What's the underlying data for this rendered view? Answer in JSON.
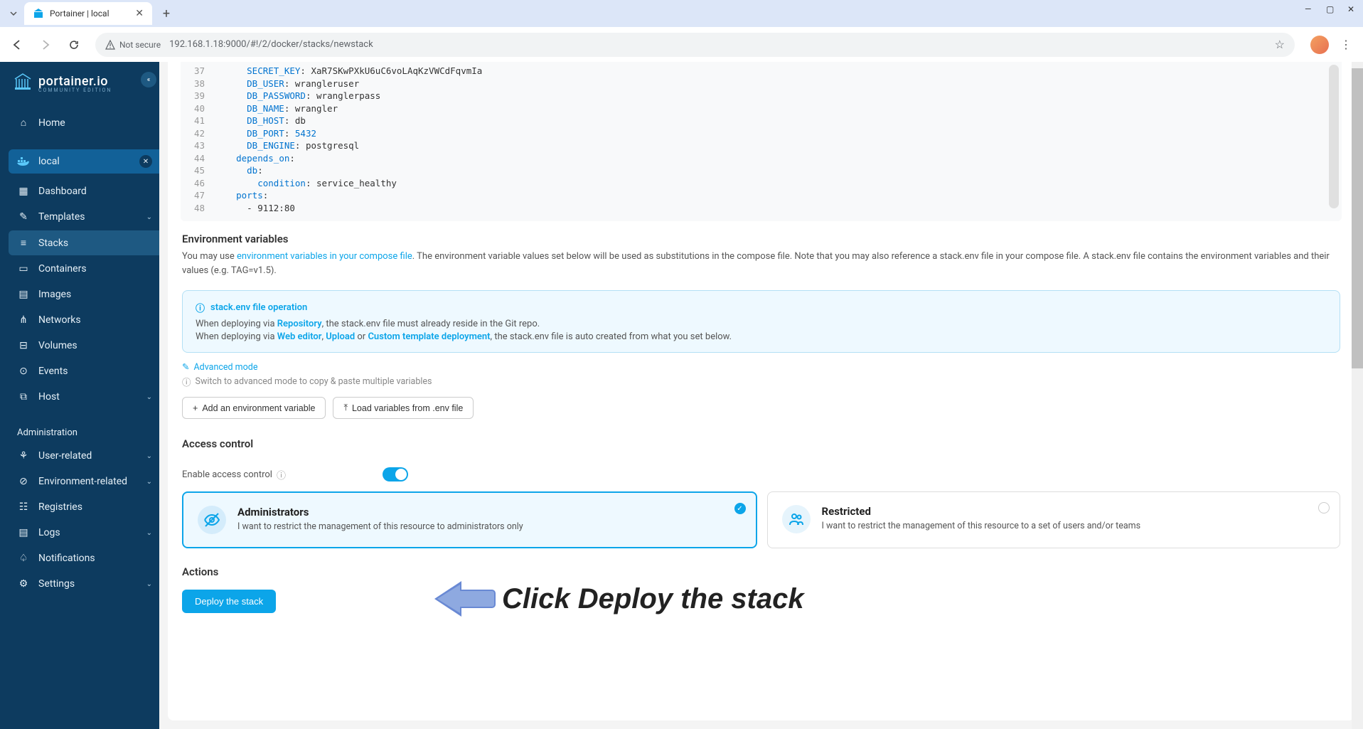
{
  "browser": {
    "tab_title": "Portainer | local",
    "url_security": "Not secure",
    "url": "192.168.1.18:9000/#!/2/docker/stacks/newstack"
  },
  "sidebar": {
    "logo_main": "portainer.io",
    "logo_sub": "COMMUNITY EDITION",
    "home": "Home",
    "env_label": "local",
    "items": [
      {
        "label": "Dashboard"
      },
      {
        "label": "Templates"
      },
      {
        "label": "Stacks"
      },
      {
        "label": "Containers"
      },
      {
        "label": "Images"
      },
      {
        "label": "Networks"
      },
      {
        "label": "Volumes"
      },
      {
        "label": "Events"
      },
      {
        "label": "Host"
      }
    ],
    "admin_label": "Administration",
    "admin_items": [
      {
        "label": "User-related"
      },
      {
        "label": "Environment-related"
      },
      {
        "label": "Registries"
      },
      {
        "label": "Logs"
      },
      {
        "label": "Notifications"
      },
      {
        "label": "Settings"
      }
    ]
  },
  "editor": {
    "lines": [
      {
        "n": 37,
        "indent": 6,
        "key": "SECRET_KEY",
        "val": "XaR7SKwPXkU6uC6voLAqKzVWCdFqvmIa"
      },
      {
        "n": 38,
        "indent": 6,
        "key": "DB_USER",
        "val": "wrangleruser"
      },
      {
        "n": 39,
        "indent": 6,
        "key": "DB_PASSWORD",
        "val": "wranglerpass"
      },
      {
        "n": 40,
        "indent": 6,
        "key": "DB_NAME",
        "val": "wrangler"
      },
      {
        "n": 41,
        "indent": 6,
        "key": "DB_HOST",
        "val": "db"
      },
      {
        "n": 42,
        "indent": 6,
        "key": "DB_PORT",
        "val": "5432",
        "num": true
      },
      {
        "n": 43,
        "indent": 6,
        "key": "DB_ENGINE",
        "val": "postgresql"
      },
      {
        "n": 44,
        "indent": 4,
        "key": "depends_on",
        "val": ""
      },
      {
        "n": 45,
        "indent": 6,
        "key": "db",
        "val": ""
      },
      {
        "n": 46,
        "indent": 8,
        "key": "condition",
        "val": "service_healthy"
      },
      {
        "n": 47,
        "indent": 4,
        "key": "ports",
        "val": ""
      },
      {
        "n": 48,
        "indent": 6,
        "raw": "- 9112:80"
      }
    ]
  },
  "env_section": {
    "title": "Environment variables",
    "desc_pre": "You may use ",
    "desc_link": "environment variables in your compose file",
    "desc_post": ". The environment variable values set below will be used as substitutions in the compose file. Note that you may also reference a stack.env file in your compose file. A stack.env file contains the environment variables and their values (e.g. TAG=v1.5).",
    "info_title": "stack.env file operation",
    "info_l1_pre": "When deploying via ",
    "info_l1_kw": "Repository",
    "info_l1_post": ", the stack.env file must already reside in the Git repo.",
    "info_l2_pre": "When deploying via ",
    "info_l2_kw1": "Web editor",
    "info_l2_sep1": ", ",
    "info_l2_kw2": "Upload",
    "info_l2_sep2": " or ",
    "info_l2_kw3": "Custom template deployment",
    "info_l2_post": ", the stack.env file is auto created from what you set below.",
    "adv_link": "Advanced mode",
    "adv_hint": "Switch to advanced mode to copy & paste multiple variables",
    "btn_add": "Add an environment variable",
    "btn_load": "Load variables from .env file"
  },
  "access": {
    "title": "Access control",
    "toggle_label": "Enable access control",
    "admin_title": "Administrators",
    "admin_desc": "I want to restrict the management of this resource to administrators only",
    "restricted_title": "Restricted",
    "restricted_desc": "I want to restrict the management of this resource to a set of users and/or teams"
  },
  "actions": {
    "title": "Actions",
    "deploy": "Deploy the stack"
  },
  "annotation": {
    "text": "Click Deploy the stack"
  }
}
